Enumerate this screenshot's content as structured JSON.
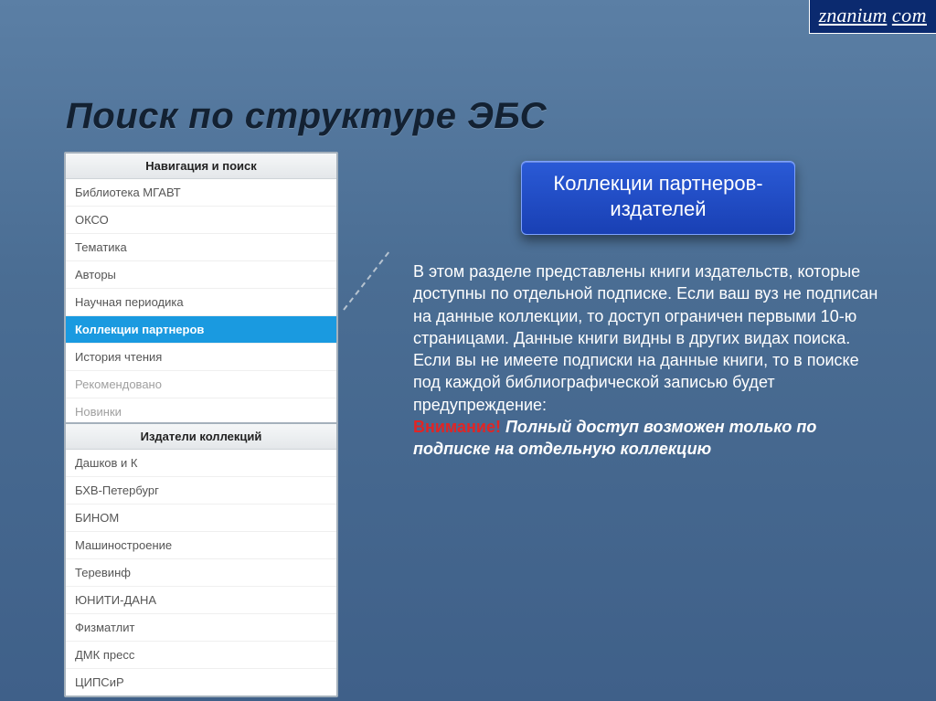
{
  "logo": {
    "w1": "znanium",
    "w2": "com"
  },
  "title": "Поиск по структуре ЭБС",
  "nav": {
    "header": "Навигация и поиск",
    "items": [
      {
        "label": "Библиотека МГАВТ",
        "active": false
      },
      {
        "label": "ОКСО",
        "active": false
      },
      {
        "label": "Тематика",
        "active": false
      },
      {
        "label": "Авторы",
        "active": false
      },
      {
        "label": "Научная периодика",
        "active": false
      },
      {
        "label": "Коллекции партнеров",
        "active": true
      },
      {
        "label": "История чтения",
        "active": false
      },
      {
        "label": "Рекомендовано",
        "active": false,
        "muted": true
      },
      {
        "label": "Новинки",
        "active": false,
        "muted": true
      }
    ]
  },
  "publishers": {
    "header": "Издатели коллекций",
    "items": [
      {
        "label": "Дашков и К"
      },
      {
        "label": "БХВ-Петербург"
      },
      {
        "label": "БИНОМ"
      },
      {
        "label": "Машиностроение"
      },
      {
        "label": "Теревинф"
      },
      {
        "label": "ЮНИТИ-ДАНА"
      },
      {
        "label": "Физматлит"
      },
      {
        "label": "ДМК пресс"
      },
      {
        "label": "ЦИПСиР"
      }
    ]
  },
  "callout": {
    "line1": "Коллекции партнеров-",
    "line2": "издателей"
  },
  "desc": {
    "body": "В этом разделе представлены книги издательств, которые доступны по отдельной подписке. Если ваш вуз не подписан на данные коллекции, то доступ ограничен первыми 10-ю страницами. Данные книги видны в других видах поиска. Если вы не имеете подписки на данные книги, то в поиске под каждой библиографической записью будет предупреждение:",
    "warn": "Внимание!",
    "ital": " Полный доступ возможен только по подписке на отдельную коллекцию"
  }
}
